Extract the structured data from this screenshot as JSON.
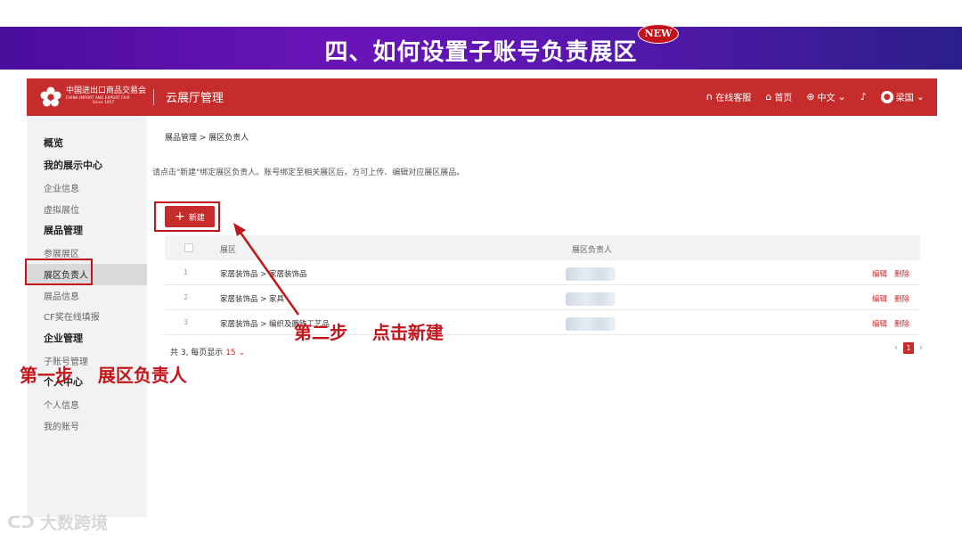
{
  "banner": {
    "title": "四、如何设置子账号负责展区",
    "badge": "NEW"
  },
  "topbar": {
    "logo_line1": "中国进出口商品交易会",
    "logo_line2": "CHINA IMPORT AND EXPORT FAIR",
    "logo_line3": "Since 1957",
    "app_title": "云展厅管理",
    "nav": {
      "service": "在线客服",
      "home": "首页",
      "lang": "中文",
      "user": "梁国"
    },
    "brand_color": "#c72c2c"
  },
  "sidebar": {
    "overview": "概览",
    "my_center": "我的展示中心",
    "company_info": "企业信息",
    "virtual_booth": "虚拟展位",
    "product_mgmt": "展品管理",
    "exhibit_zone": "参展展区",
    "zone_owner": "展区负责人",
    "product_info": "展品信息",
    "cf_award": "CF奖在线填报",
    "company_mgmt": "企业管理",
    "sub_account": "子账号管理",
    "personal_center": "个人中心",
    "personal_info": "个人信息",
    "my_account": "我的账号"
  },
  "main": {
    "breadcrumb": "展品管理 > 展区负责人",
    "tip": "请点击\"新建\"绑定展区负责人。账号绑定至相关展区后，方可上传、编辑对应展区展品。",
    "new_button": "新建",
    "table": {
      "headers": {
        "zone": "展区",
        "owner": "展区负责人"
      },
      "rows": [
        {
          "idx": "1",
          "zone": "家居装饰品 > 家居装饰品",
          "edit": "编辑",
          "delete": "删除"
        },
        {
          "idx": "2",
          "zone": "家居装饰品 > 家具",
          "edit": "编辑",
          "delete": "删除"
        },
        {
          "idx": "3",
          "zone": "家居装饰品 > 编织及藤铁工艺品",
          "edit": "编辑",
          "delete": "删除"
        }
      ]
    },
    "footer": {
      "total": "共 3, 每页显示",
      "page_size": "15"
    },
    "pager": {
      "current": "1"
    }
  },
  "annotations": {
    "step1": "第一步    展区负责人",
    "step2": "第二步    点击新建",
    "color": "#c3161c"
  },
  "watermark": {
    "text": "大数跨境"
  }
}
